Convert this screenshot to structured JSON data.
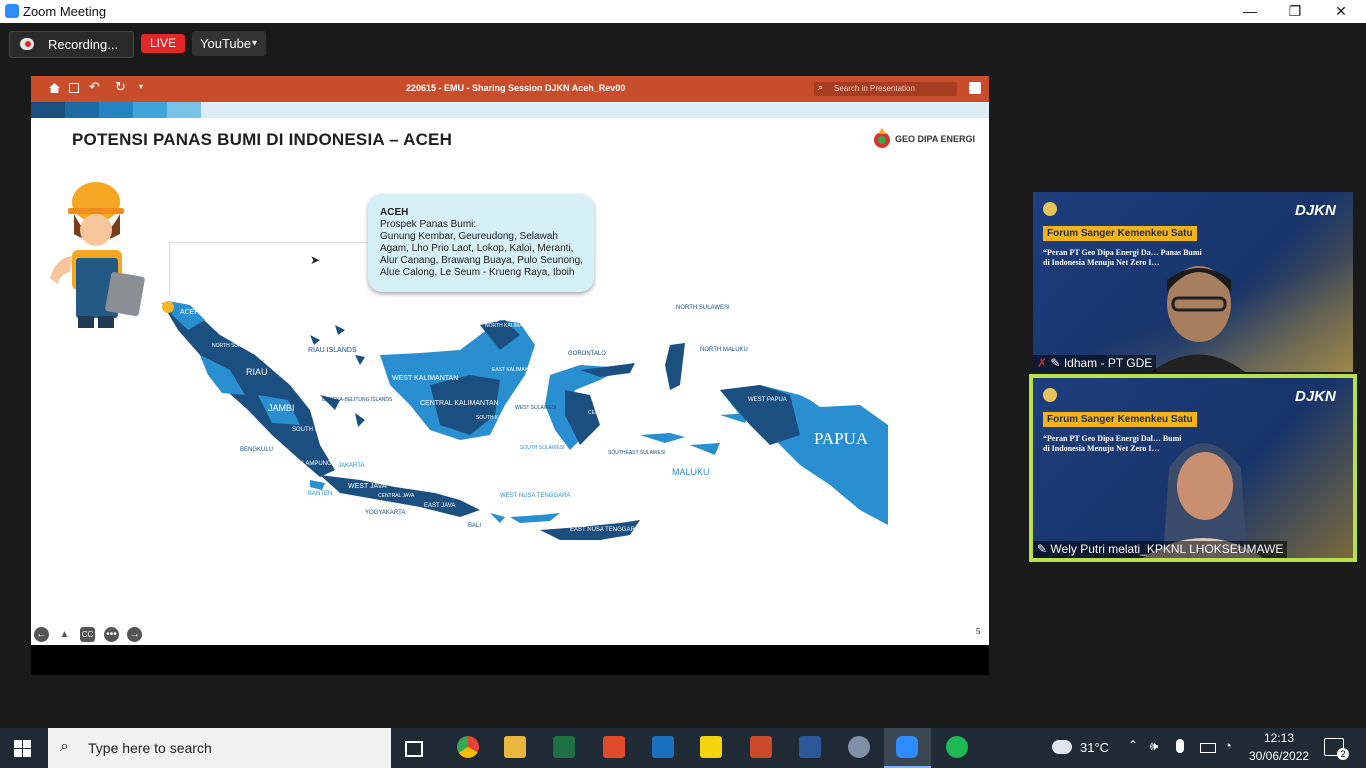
{
  "window": {
    "title": "Zoom Meeting",
    "minimize": "—",
    "maximize": "❐",
    "close": "✕"
  },
  "toolbar": {
    "recording_label": "Recording...",
    "live_label": "LIVE",
    "stream_label": "YouTube",
    "stream_caret": "▾"
  },
  "ppt": {
    "filename": "220615 - EMU - Sharing Session DJKN Aceh_Rev00",
    "search_placeholder": "Search in Presentation"
  },
  "slide": {
    "title": "POTENSI PANAS BUMI DI INDONESIA – ACEH",
    "logo_text": "GEO DIPA ENERGI",
    "page_number": "5",
    "bubble_heading": "ACEH",
    "bubble_lines": [
      "Prospek Panas Bumi:",
      "Gunung Kembar, Geureudong, Selawah",
      "Agam, Lho Prio Laot, Lokop, Kaloi, Meranti,",
      "Alur Canang, Brawang Buaya, Pulo Seunong,",
      "Alue Calong, Le Seum - Krueng Raya, Iboih"
    ],
    "map_labels": {
      "aceh": "ACEH",
      "north_sumatra": "NORTH SUMATRA",
      "riau": "RIAU",
      "riau_islands": "RIAU ISLANDS",
      "jambi": "JAMBI",
      "south_sumatra": "SOUTH SUMATRA",
      "bangka": "BANGKA-BELITUNG ISLANDS",
      "bengkulu": "BENGKULU",
      "lampung": "LAMPUNG",
      "jakarta": "JAKARTA",
      "banten": "BANTEN",
      "west_java": "WEST JAVA",
      "central_java": "CENTRAL JAVA",
      "yogyakarta": "YOGYAKARTA",
      "east_java": "EAST JAVA",
      "bali": "BALI",
      "west_ntt": "WEST NUSA TENGGARA",
      "east_ntt": "EAST NUSA TENGGARA",
      "west_kal": "WEST KALIMANTAN",
      "central_kal": "CENTRAL KALIMANTAN",
      "east_kal": "EAST KALIMANTAN",
      "north_kal": "NORTH KALIMANTAN",
      "south_kal": "SOUTH KALIMANTAN",
      "west_sul": "WEST SULAWESI",
      "central_sul": "CENTRAL SULAWESI",
      "south_sul": "SOUTH SULAWESI",
      "southeast_sul": "SOUTHEAST SULAWESI",
      "gorontalo": "GORONTALO",
      "north_sul": "NORTH SULAWESI",
      "north_maluku": "NORTH MALUKU",
      "maluku": "MALUKU",
      "west_papua": "WEST PAPUA",
      "papua": "PAPUA"
    }
  },
  "participants": [
    {
      "name": "Idham - PT GDE",
      "banner": "Forum Sanger Kemenkeu Satu",
      "subtitle_1": "“Peran PT Geo Dipa Energi Da… Panas Bumi",
      "subtitle_2": "di Indonesia Menuju Net Zero I…",
      "brand": "DJKN"
    },
    {
      "name": "Wely Putri melati_KPKNL LHOKSEUMAWE",
      "banner": "Forum Sanger Kemenkeu Satu",
      "subtitle_1": "“Peran PT Geo Dipa Energi Dal… Bumi",
      "subtitle_2": "di Indonesia Menuju Net Zero I…",
      "brand": "DJKN"
    }
  ],
  "taskbar": {
    "search_placeholder": "Type here to search",
    "weather": "31°C",
    "time": "12:13",
    "date": "30/06/2022",
    "notifications": "2"
  },
  "colors": {
    "accent": "#2d8cff",
    "live": "#e02828",
    "ppt_bar": "#c94d2b",
    "map_dark": "#1a4f80",
    "map_light": "#2a8fd0",
    "active_border": "#b8e04a"
  }
}
